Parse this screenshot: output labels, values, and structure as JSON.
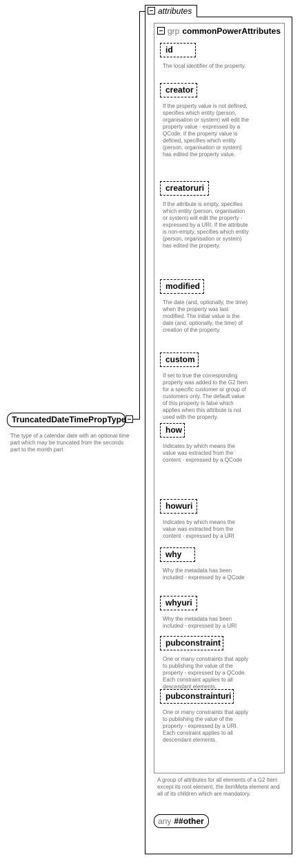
{
  "root": {
    "name": "TruncatedDateTimePropType",
    "description": "The type of a calendar date with an optional time part which may be truncated from the seconds part to the month part"
  },
  "attributes_container": {
    "label": "attributes"
  },
  "group": {
    "kind": "grp",
    "name": "commonPowerAttributes",
    "description": "A group of attributes for all elements of a G2 Item except its root element, the itemMeta element and all of its children which are mandatory."
  },
  "attributes": [
    {
      "name": "id",
      "description": "The local identifier of the property."
    },
    {
      "name": "creator",
      "description": "If the property value is not defined, specifies which entity (person, organisation or system) will edit the property value - expressed by a QCode. If the property value is defined, specifies which entity (person, organisation or system) has edited the property value."
    },
    {
      "name": "creatoruri",
      "description": "If the attribute is empty, specifies which entity (person, organisation or system) will edit the property - expressed by a URI. If the attribute is non-empty, specifies which entity (person, organisation or system) has edited the property."
    },
    {
      "name": "modified",
      "description": "The date (and, optionally, the time) when the property was last modified. The initial value is the date (and, optionally, the time) of creation of the property."
    },
    {
      "name": "custom",
      "description": "If set to true the corresponding property was added to the G2 Item for a specific customer or group of customers only. The default value of this property is false which applies when this attribute is not used with the property."
    },
    {
      "name": "how",
      "description": "Indicates by which means the value was extracted from the content - expressed by a QCode"
    },
    {
      "name": "howuri",
      "description": "Indicates by which means the value was extracted from the content - expressed by a URI"
    },
    {
      "name": "why",
      "description": "Why the metadata has been included - expressed by a QCode"
    },
    {
      "name": "whyuri",
      "description": "Why the metadata has been included - expressed by a URI"
    },
    {
      "name": "pubconstraint",
      "description": "One or many constraints that apply to publishing the value of the property - expressed by a QCode. Each constraint applies to all descendant elements."
    },
    {
      "name": "pubconstrainturi",
      "description": "One or many constraints that apply to publishing the value of the property - expressed by a URI. Each constraint applies to all descendant elements."
    }
  ],
  "any_attribute": {
    "keyword": "any",
    "namespace": "##other"
  },
  "icons": {
    "collapse": "minus-square-icon"
  }
}
